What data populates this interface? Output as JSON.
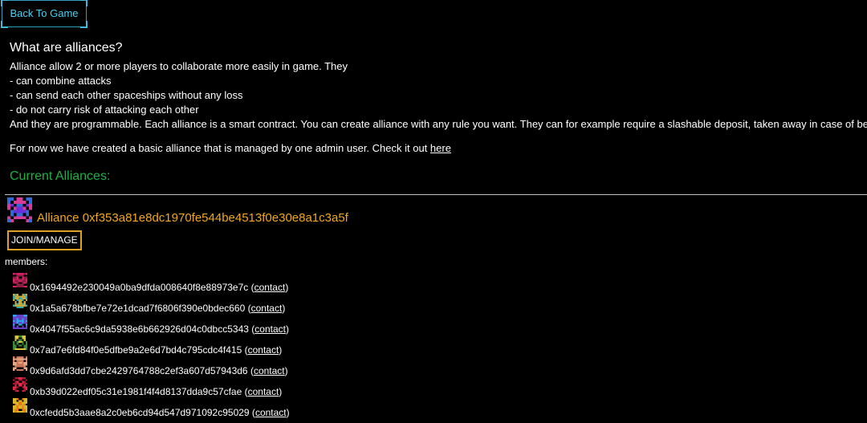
{
  "back_button": {
    "label": "Back To Game"
  },
  "intro": {
    "heading": "What are alliances?",
    "lines": [
      "Alliance allow 2 or more players to collaborate more easily in game. They",
      "- can combine attacks",
      "- can send each other spaceships without any loss",
      "- do not carry risk of attacking each other",
      "And they are programmable. Each alliance is a smart contract. You can create alliance with any rule you want. They can for example require a slashable deposit, taken away in case of betrayal."
    ],
    "basic_text": "For now we have created a basic alliance that is managed by one admin user. Check it out ",
    "basic_link": "here"
  },
  "current_title": "Current Alliances:",
  "alliance": {
    "name": "Alliance 0xf353a81e8dc1970fe544be4513f0e30e8a1c3a5f",
    "join_label": "JOIN/MANAGE",
    "members_label": "members:",
    "icon_colors": [
      "#6a2fd8",
      "#d83a9a",
      "#2f6ad8"
    ]
  },
  "members": [
    {
      "address": "0x1694492e230049a0ba9dfda008640f8e88973e7c",
      "contact_label": "contact",
      "colors": [
        "#d8206a",
        "#8a2040"
      ]
    },
    {
      "address": "0x1a5a678bfbe7e72e1dcad7f6806f390e0bdec660",
      "contact_label": "contact",
      "colors": [
        "#30a8a8",
        "#c8a838"
      ]
    },
    {
      "address": "0x4047f55ac6c9da5938e6b662926d04c0dbcc5343",
      "contact_label": "contact",
      "colors": [
        "#28a8e8",
        "#6a40c8"
      ]
    },
    {
      "address": "0x7ad7e6fd84f0e5dfbe9a2e6d7bd4c795cdc4f415",
      "contact_label": "contact",
      "colors": [
        "#d8c838",
        "#3a8a3a"
      ]
    },
    {
      "address": "0x9d6afd3dd7cbe2429764788c2ef3a607d57943d6",
      "contact_label": "contact",
      "colors": [
        "#e8a888",
        "#c87858"
      ]
    },
    {
      "address": "0xb39d022edf05c31e1981f4f4d8137dda9c57cfae",
      "contact_label": "contact",
      "colors": [
        "#e82848",
        "#a81830"
      ]
    },
    {
      "address": "0xcfedd5b3aae8a2c0eb6cd94d547d971092c95029",
      "contact_label": "contact",
      "colors": [
        "#e87818",
        "#d8b828"
      ]
    }
  ]
}
